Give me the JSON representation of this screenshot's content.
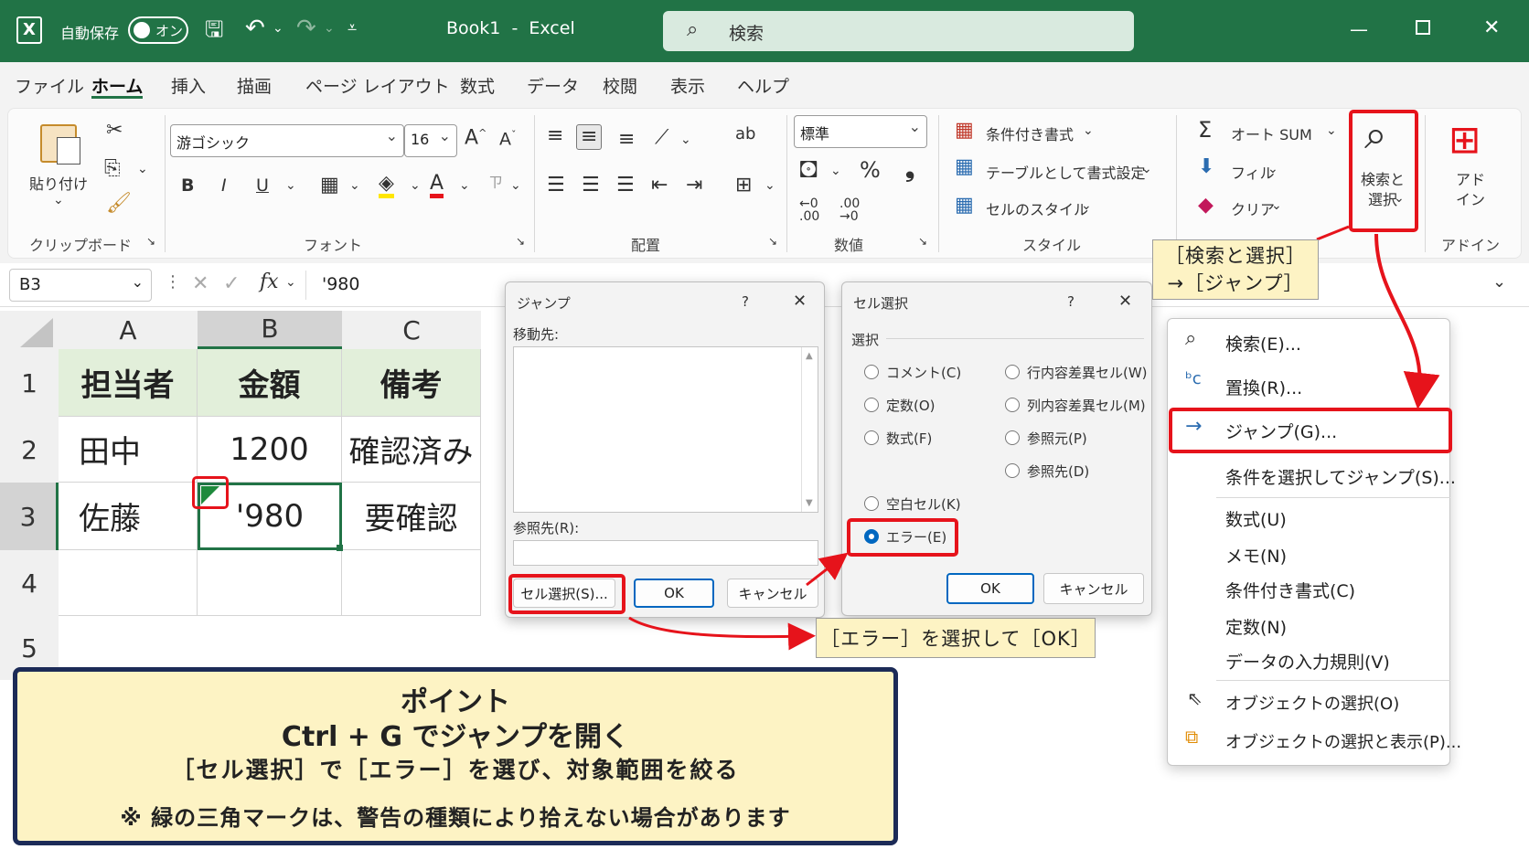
{
  "titlebar": {
    "autosave_label": "自動保存",
    "autosave_toggle": "オン",
    "title": "Book1  -  Excel",
    "search_placeholder": "検索"
  },
  "menu": [
    "ファイル",
    "ホーム",
    "挿入",
    "描画",
    "ページ レイアウト",
    "数式",
    "データ",
    "校閲",
    "表示",
    "ヘルプ"
  ],
  "ribbon": {
    "paste": "貼り付け",
    "clipboard": "クリップボード",
    "font_name": "游ゴシック",
    "font_size": "16",
    "font_group": "フォント",
    "bold": "B",
    "italic": "I",
    "underline": "U",
    "align_group": "配置",
    "number_format": "標準",
    "number_group": "数値",
    "cond_format": "条件付き書式",
    "table_format": "テーブルとして書式設定",
    "cell_style": "セルのスタイル",
    "style_group": "スタイル",
    "autosum": "オート SUM",
    "fill": "フィル",
    "clear": "クリア",
    "find_select": "検索と\n選択",
    "addin": "アド\nイン",
    "addin_group": "アドイン"
  },
  "formula_bar": {
    "name_box": "B3",
    "formula": "'980"
  },
  "sheet": {
    "columns": [
      "A",
      "B",
      "C"
    ],
    "rows": [
      "1",
      "2",
      "3",
      "4",
      "5"
    ],
    "cells": [
      [
        "担当者",
        "金額",
        "備考"
      ],
      [
        "田中",
        "1200",
        "確認済み"
      ],
      [
        "佐藤",
        "'980",
        "要確認"
      ]
    ]
  },
  "jump_dialog": {
    "title": "ジャンプ",
    "help": "?",
    "close": "✕",
    "goto_label": "移動先:",
    "ref_label": "参照先(R):",
    "special_button": "セル選択(S)...",
    "ok": "OK",
    "cancel": "キャンセル"
  },
  "select_dialog": {
    "title": "セル選択",
    "help": "?",
    "close": "✕",
    "group_label": "選択",
    "options_left": [
      "コメント(C)",
      "定数(O)",
      "数式(F)",
      "空白セル(K)",
      "エラー(E)"
    ],
    "options_right": [
      "行内容差異セル(W)",
      "列内容差異セル(M)",
      "参照元(P)",
      "参照先(D)"
    ],
    "selected": "エラー(E)",
    "ok": "OK",
    "cancel": "キャンセル"
  },
  "dropdown": {
    "items": [
      "検索(E)...",
      "置換(R)...",
      "ジャンプ(G)...",
      "条件を選択してジャンプ(S)...",
      "数式(U)",
      "メモ(N)",
      "条件付き書式(C)",
      "定数(N)",
      "データの入力規則(V)",
      "オブジェクトの選択(O)",
      "オブジェクトの選択と表示(P)..."
    ]
  },
  "callouts": {
    "find_select_line1": "［検索と選択］",
    "find_select_line2": "→［ジャンプ］",
    "select_error": "［エラー］を選択して［OK］"
  },
  "point": {
    "title": "ポイント",
    "line1": "Ctrl + G でジャンプを開く",
    "line2": "［セル選択］で［エラー］を選び、対象範囲を絞る",
    "line3": "※ 緑の三角マークは、警告の種類により拾えない場合があります"
  },
  "colors": {
    "excel_green": "#217346",
    "highlight_red": "#e6131b",
    "callout_yellow": "#fdf3c4",
    "header_fill": "#e2efda"
  }
}
